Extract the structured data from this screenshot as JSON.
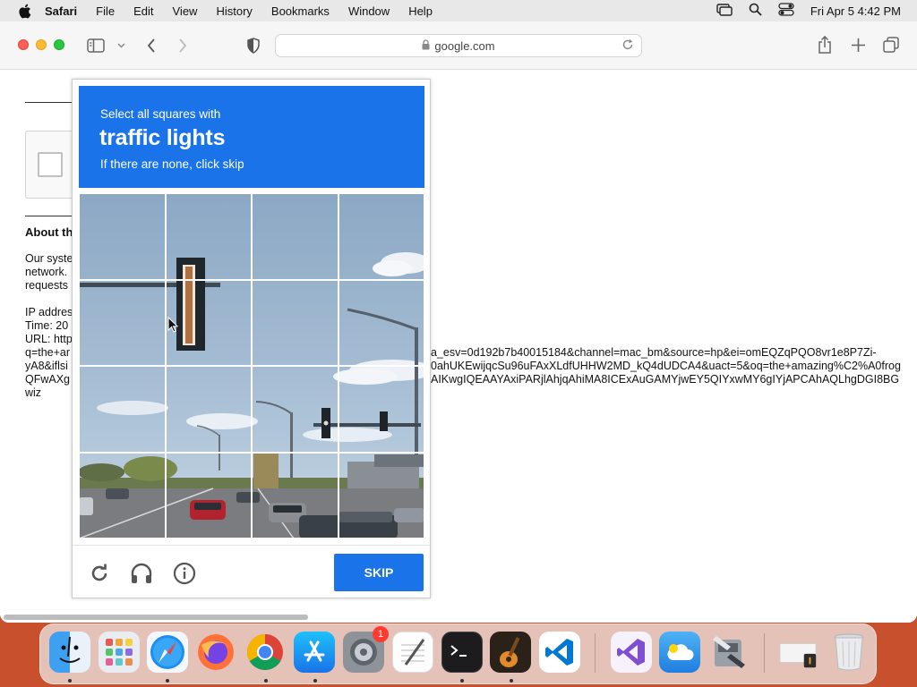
{
  "menubar": {
    "app_name": "Safari",
    "items": [
      "File",
      "Edit",
      "View",
      "History",
      "Bookmarks",
      "Window",
      "Help"
    ],
    "clock": "Fri Apr 5  4:42 PM"
  },
  "toolbar": {
    "url": "google.com"
  },
  "page": {
    "about_heading": "About th",
    "para1": [
      "Our syste",
      "network.",
      "requests"
    ],
    "ip_label": "IP addres",
    "time_label": "Time: 20",
    "url_label": "URL: http",
    "url_lines_left": [
      "q=the+ar",
      "yA8&iflsi",
      "QFwAXg",
      "wiz"
    ],
    "url_lines_right": [
      "a_esv=0d192b7b40015184&channel=mac_bm&source=hp&ei=omEQZqPQO8vr1e8P7Zi-",
      "0ahUKEwijqcSu96uFAxXLdfUHHW2MD_kQ4dUDCA4&uact=5&oq=the+amazing%C2%A0frog",
      "AIKwgIQEAAYAxiPARjlAhjqAhiMA8ICExAuGAMYjwEY5QIYxwMY6gIYjAPCAhAQLhgDGI8BG"
    ]
  },
  "captcha": {
    "line1": "Select all squares with",
    "target": "traffic lights",
    "line3": "If there are none, click skip",
    "skip_label": "SKIP",
    "icons": [
      "reload-icon",
      "audio-icon",
      "info-icon"
    ]
  },
  "dock": {
    "apps": [
      "Finder",
      "Launchpad",
      "Safari",
      "Firefox",
      "Chrome",
      "App Store",
      "System Settings",
      "TextEdit",
      "Terminal",
      "GarageBand",
      "Visual Studio Code",
      "Visual Studio",
      "iCloud",
      "Migration Assistant",
      "Downloads",
      "Trash"
    ],
    "settings_badge": "1"
  }
}
